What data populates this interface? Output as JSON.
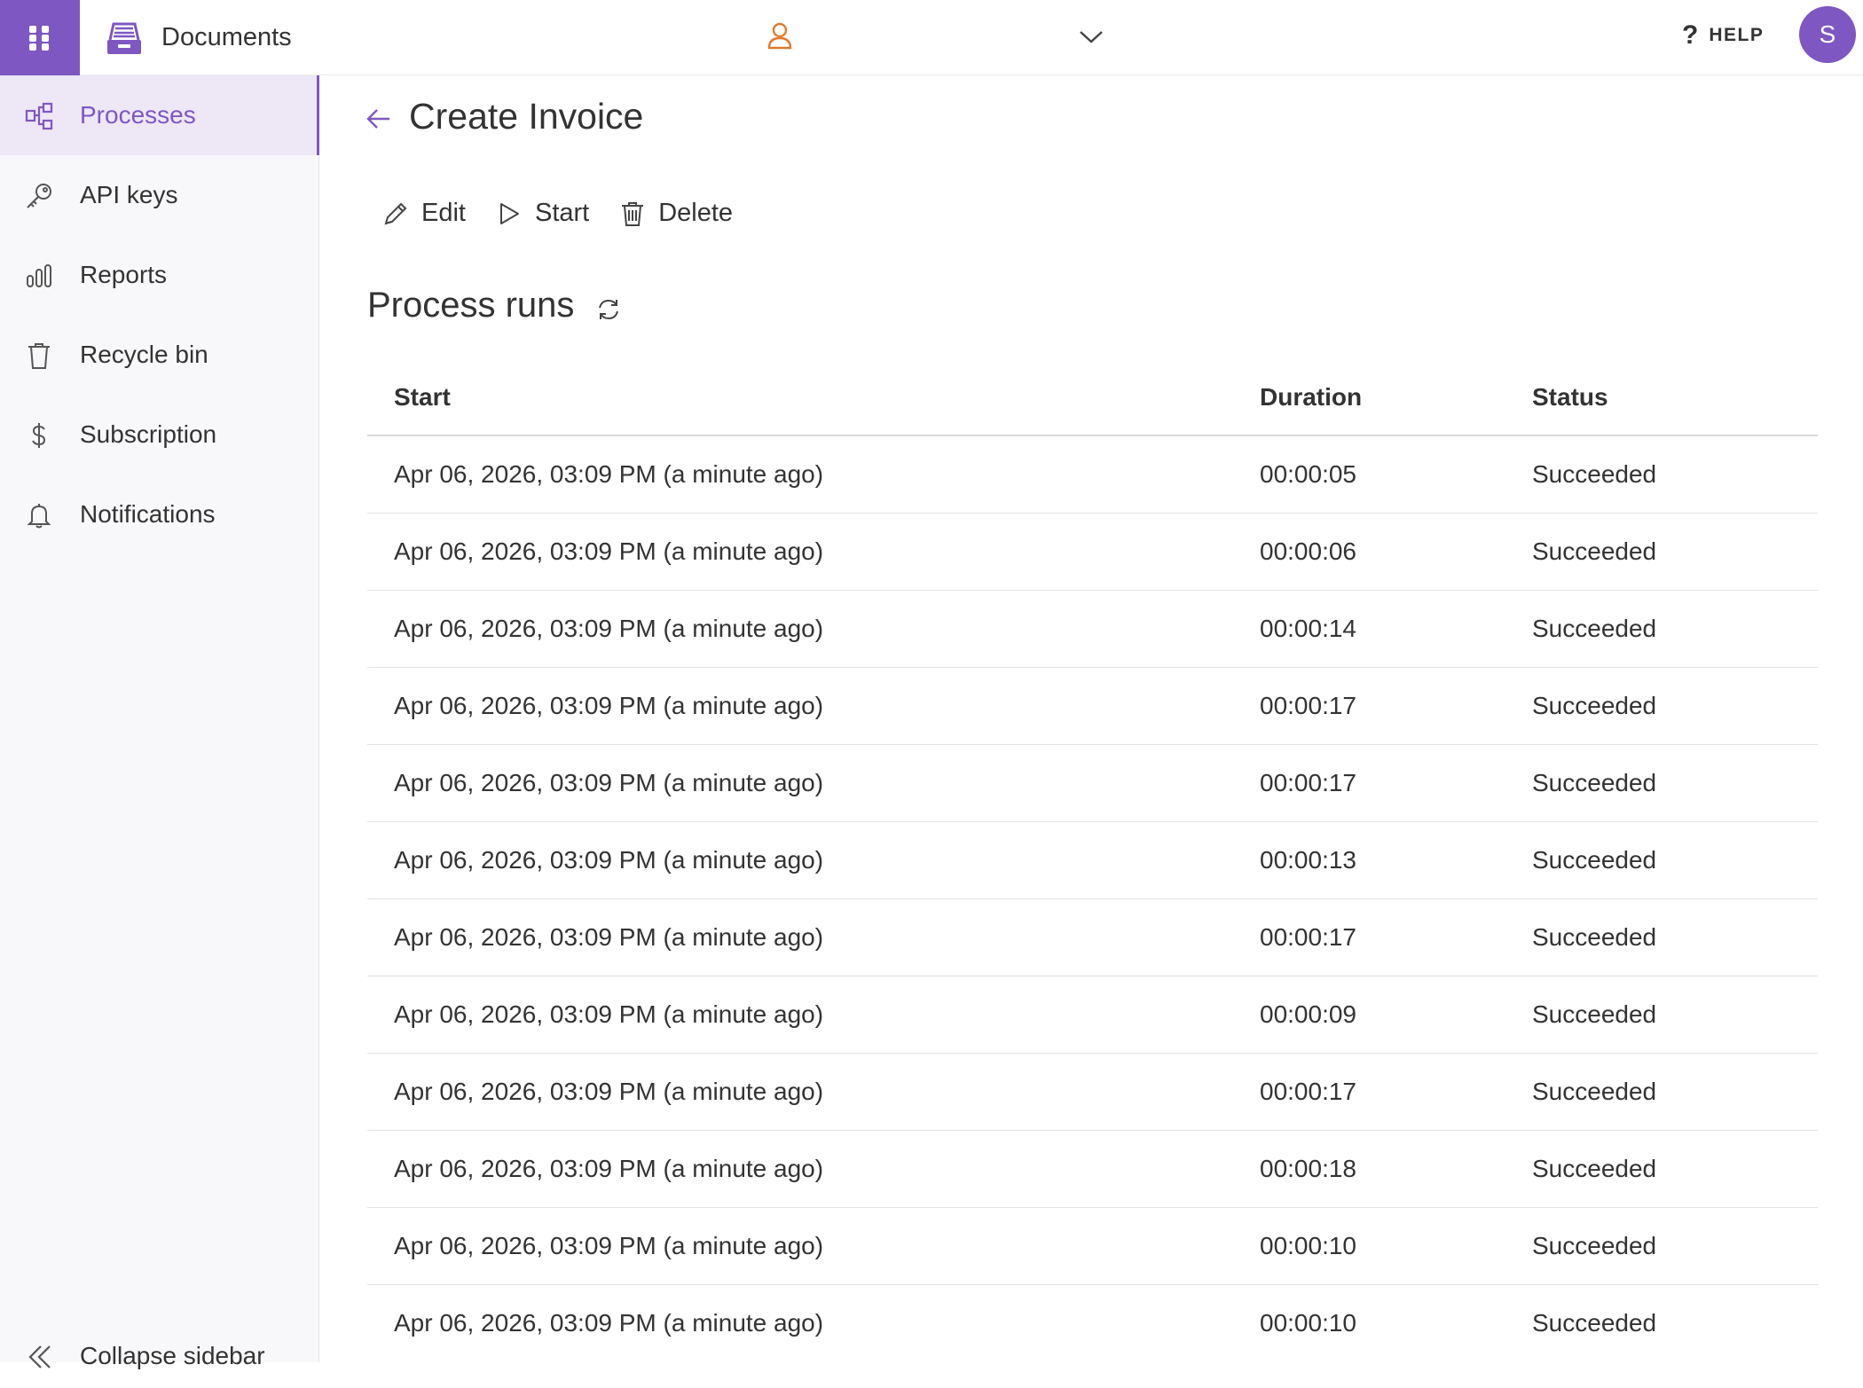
{
  "topbar": {
    "app_title": "Documents",
    "help_symbol": "?",
    "help_label": "HELP",
    "avatar_initial": "S",
    "icons": [
      "app-grid-icon",
      "documents-logo-icon",
      "user-icon",
      "chevron-down-icon"
    ]
  },
  "sidebar": {
    "items": [
      {
        "label": "Processes",
        "icon": "processes-icon",
        "active": true
      },
      {
        "label": "API keys",
        "icon": "key-icon",
        "active": false
      },
      {
        "label": "Reports",
        "icon": "bar-chart-icon",
        "active": false
      },
      {
        "label": "Recycle bin",
        "icon": "trash-icon",
        "active": false
      },
      {
        "label": "Subscription",
        "icon": "dollar-icon",
        "active": false
      },
      {
        "label": "Notifications",
        "icon": "bell-icon",
        "active": false
      }
    ],
    "collapse_label": "Collapse sidebar"
  },
  "main": {
    "title": "Create Invoice",
    "actions": {
      "edit": "Edit",
      "start": "Start",
      "delete": "Delete"
    },
    "section_title": "Process runs",
    "table": {
      "columns": [
        "Start",
        "Duration",
        "Status"
      ],
      "rows": [
        {
          "start": "Apr 06, 2026, 03:09 PM (a minute ago)",
          "duration": "00:00:05",
          "status": "Succeeded"
        },
        {
          "start": "Apr 06, 2026, 03:09 PM (a minute ago)",
          "duration": "00:00:06",
          "status": "Succeeded"
        },
        {
          "start": "Apr 06, 2026, 03:09 PM (a minute ago)",
          "duration": "00:00:14",
          "status": "Succeeded"
        },
        {
          "start": "Apr 06, 2026, 03:09 PM (a minute ago)",
          "duration": "00:00:17",
          "status": "Succeeded"
        },
        {
          "start": "Apr 06, 2026, 03:09 PM (a minute ago)",
          "duration": "00:00:17",
          "status": "Succeeded"
        },
        {
          "start": "Apr 06, 2026, 03:09 PM (a minute ago)",
          "duration": "00:00:13",
          "status": "Succeeded"
        },
        {
          "start": "Apr 06, 2026, 03:09 PM (a minute ago)",
          "duration": "00:00:17",
          "status": "Succeeded"
        },
        {
          "start": "Apr 06, 2026, 03:09 PM (a minute ago)",
          "duration": "00:00:09",
          "status": "Succeeded"
        },
        {
          "start": "Apr 06, 2026, 03:09 PM (a minute ago)",
          "duration": "00:00:17",
          "status": "Succeeded"
        },
        {
          "start": "Apr 06, 2026, 03:09 PM (a minute ago)",
          "duration": "00:00:18",
          "status": "Succeeded"
        },
        {
          "start": "Apr 06, 2026, 03:09 PM (a minute ago)",
          "duration": "00:00:10",
          "status": "Succeeded"
        },
        {
          "start": "Apr 06, 2026, 03:09 PM (a minute ago)",
          "duration": "00:00:10",
          "status": "Succeeded"
        }
      ]
    }
  },
  "colors": {
    "accent": "#7e57c2",
    "active_bg": "#ede7f6",
    "user_icon": "#e07a2e",
    "text": "#333333"
  }
}
